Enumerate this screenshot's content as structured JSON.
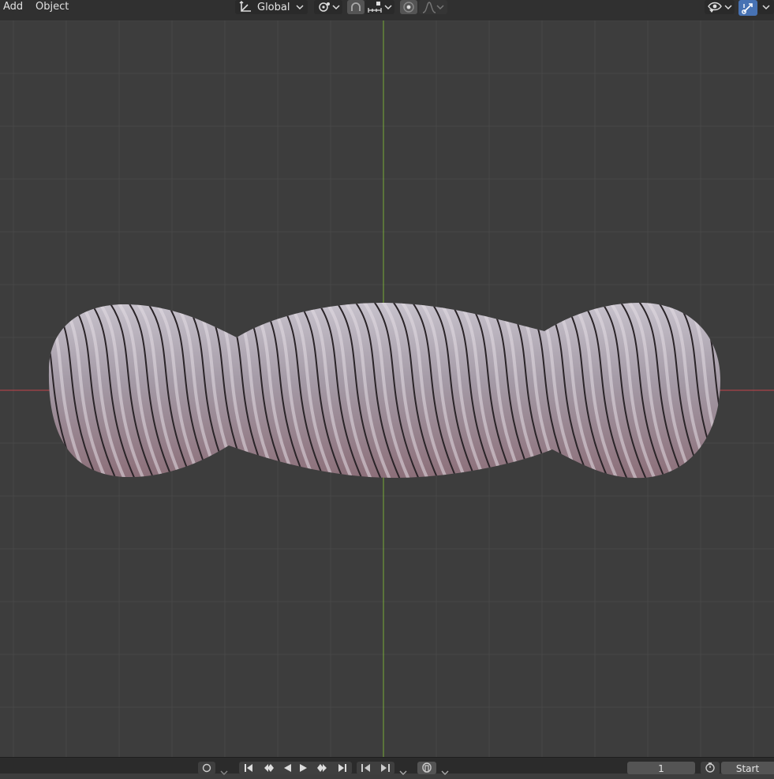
{
  "header": {
    "menus": [
      "Add",
      "Object"
    ],
    "transform_orientation": "Global",
    "icons": [
      "transform-orientation-icon",
      "pivot-point-icon",
      "snap-icon",
      "snap-increment-icon",
      "proportional-editing-icon",
      "falloff-curve-icon",
      "visibility-icon",
      "gizmo-icon"
    ]
  },
  "viewport": {
    "background": "#3d3d3d",
    "grid_color": "#484848",
    "x_axis_color": "#b34848",
    "y_axis_color": "#6e9a3a",
    "object_color": "#9a8c96"
  },
  "timeline": {
    "current_frame": "1",
    "start_label": "Start",
    "icons": [
      "keying-icon",
      "jump-start-icon",
      "prev-keyframe-icon",
      "play-reverse-icon",
      "play-icon",
      "next-keyframe-icon",
      "jump-end-icon",
      "prev-marker-icon",
      "next-marker-icon",
      "auto-key-icon",
      "stopwatch-icon"
    ]
  }
}
